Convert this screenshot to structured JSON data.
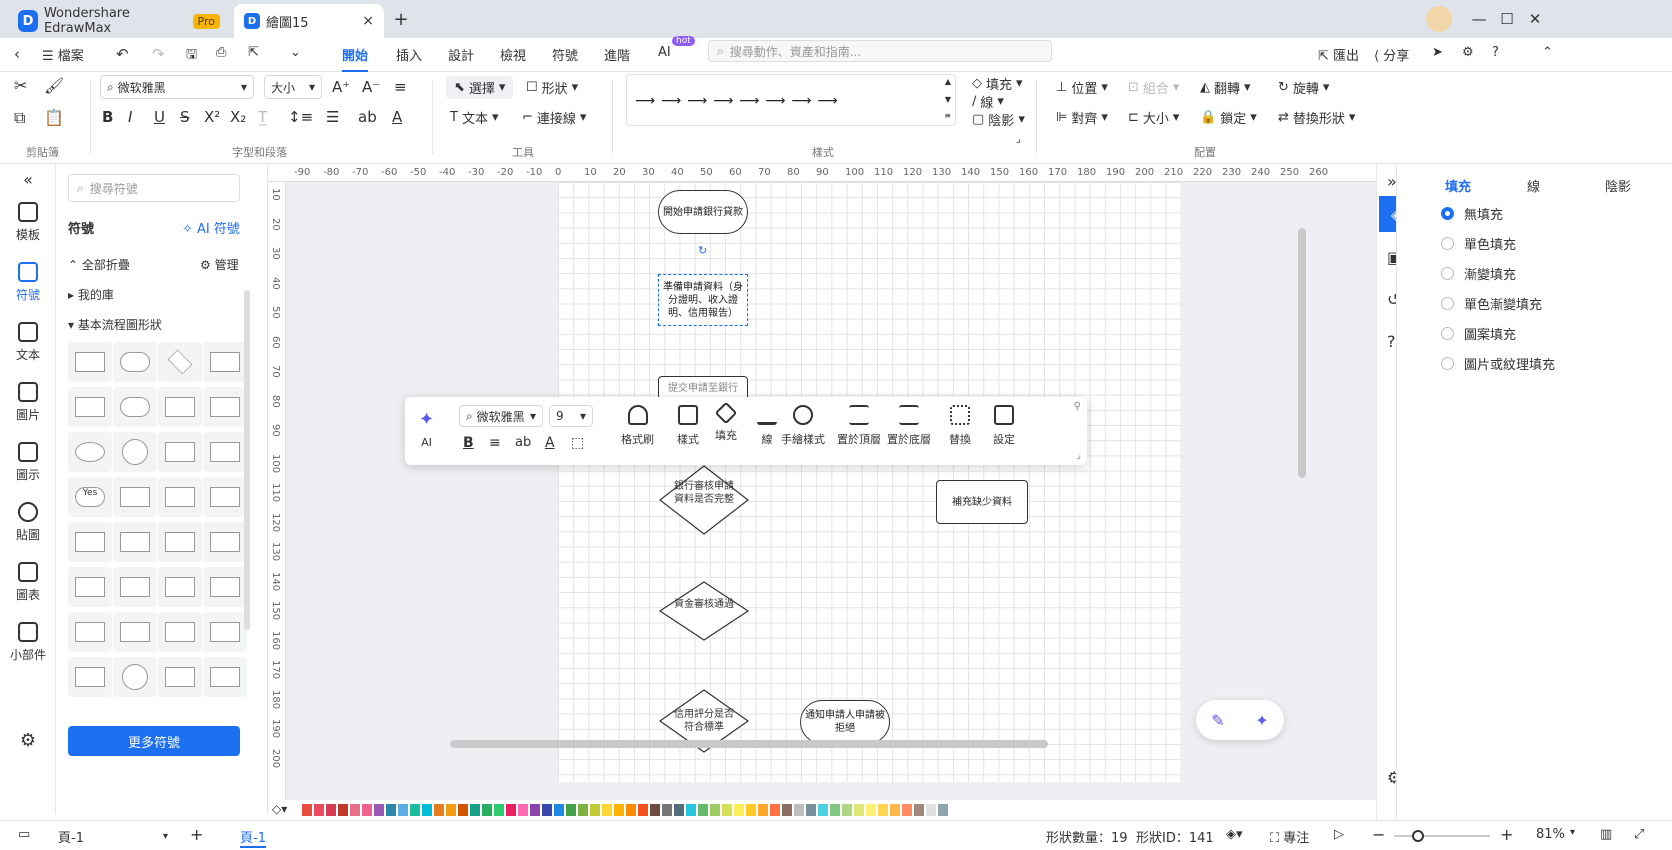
{
  "app": {
    "name": "Wondershare EdrawMax",
    "badge": "Pro",
    "doc_tab": "繪圖15"
  },
  "menubar": {
    "file": "檔案",
    "tabs": [
      "開始",
      "插入",
      "設計",
      "檢視",
      "符號",
      "進階",
      "AI"
    ],
    "ai_badge": "hot",
    "search_placeholder": "搜尋動作、資產和指南...",
    "export": "匯出",
    "share": "分享"
  },
  "ribbon": {
    "font": "微软雅黑",
    "size": "大小",
    "clipboard": "剪貼簿",
    "font_group": "字型和段落",
    "tools": "工具",
    "style": "樣式",
    "arrange": "配置",
    "select": "選擇",
    "shape": "形狀",
    "text": "文本",
    "connector": "連接線",
    "fill": "填充",
    "line": "線",
    "shadow": "陰影",
    "position": "位置",
    "group": "組合",
    "flip": "翻轉",
    "rotate": "旋轉",
    "align": "對齊",
    "lock": "鎖定",
    "replace": "替換形狀"
  },
  "leftnav": [
    "模板",
    "符號",
    "文本",
    "圖片",
    "圖示",
    "貼圖",
    "圖表",
    "小部件"
  ],
  "symbols": {
    "search_placeholder": "搜尋符號",
    "title": "符號",
    "ai": "AI 符號",
    "collapse_all": "全部折疊",
    "manage": "管理",
    "my_library": "我的庫",
    "basic_flow": "基本流程圖形狀",
    "more": "更多符號",
    "yes": "Yes"
  },
  "ruler_x": [
    "-90",
    "-80",
    "-70",
    "-60",
    "-50",
    "-40",
    "-30",
    "-20",
    "-10",
    "0",
    "10",
    "20",
    "30",
    "40",
    "50",
    "60",
    "70",
    "80",
    "90",
    "100",
    "110",
    "120",
    "130",
    "140",
    "150",
    "160",
    "170",
    "180",
    "190",
    "200",
    "210",
    "220",
    "230",
    "240",
    "250",
    "260"
  ],
  "ruler_y": [
    "10",
    "20",
    "30",
    "40",
    "50",
    "60",
    "70",
    "80",
    "90",
    "100",
    "110",
    "120",
    "130",
    "140",
    "150",
    "160",
    "170",
    "180",
    "190",
    "200"
  ],
  "nodes": {
    "start": "開始申請銀行貸款",
    "prepare": "準備申請資料（身分證明、收入證明、信用報告）",
    "hidden": "提交申請至銀行",
    "check": "銀行審核申請資料是否完整",
    "supplement": "補充缺少資料",
    "fund": "資金審核通過",
    "credit": "信用評分是否符合標準",
    "reject": "通知申請人申請被拒絕"
  },
  "floatbar": {
    "ai": "AI",
    "font": "微软雅黑",
    "size": "9",
    "brush": "格式刷",
    "style": "樣式",
    "fill": "填充",
    "line": "線",
    "hand": "手繪樣式",
    "front": "置於頂層",
    "back": "置於底層",
    "replace": "替換",
    "settings": "設定"
  },
  "rightpanel": {
    "tabs": [
      "填充",
      "線",
      "陰影"
    ],
    "options": [
      "無填充",
      "單色填充",
      "漸變填充",
      "單色漸變填充",
      "圖案填充",
      "圖片或紋理填充"
    ]
  },
  "status": {
    "page_select": "頁-1",
    "page_tab": "頁-1",
    "shape_count": "形狀數量：19",
    "shape_id": "形狀ID：141",
    "focus": "專注",
    "zoom": "81%"
  },
  "palette": [
    "#e74c3c",
    "#e84a5f",
    "#d63a52",
    "#c0392b",
    "#e76f8a",
    "#f06292",
    "#9b59b6",
    "#2e86ab",
    "#5dade2",
    "#1abc9c",
    "#00bcd4",
    "#e67e22",
    "#f39c12",
    "#d35400",
    "#16a085",
    "#27ae60",
    "#2ecc71",
    "#e91e63",
    "#ff69b4",
    "#8e44ad",
    "#3949ab",
    "#1e88e5",
    "#43a047",
    "#7cb342",
    "#c0ca33",
    "#fdd835",
    "#ffb300",
    "#fb8c00",
    "#f4511e",
    "#6d4c41",
    "#757575",
    "#546e7a",
    "#26c6da",
    "#66bb6a",
    "#9ccc65",
    "#d4e157",
    "#ffee58",
    "#ffca28",
    "#ffa726",
    "#ff7043",
    "#8d6e63",
    "#bdbdbd",
    "#78909c",
    "#4dd0e1",
    "#81c784",
    "#aed581",
    "#dce775",
    "#fff176",
    "#ffd54f",
    "#ffb74d",
    "#ff8a65",
    "#a1887f",
    "#e0e0e0",
    "#90a4ae"
  ],
  "accent": "#1d6ff2"
}
